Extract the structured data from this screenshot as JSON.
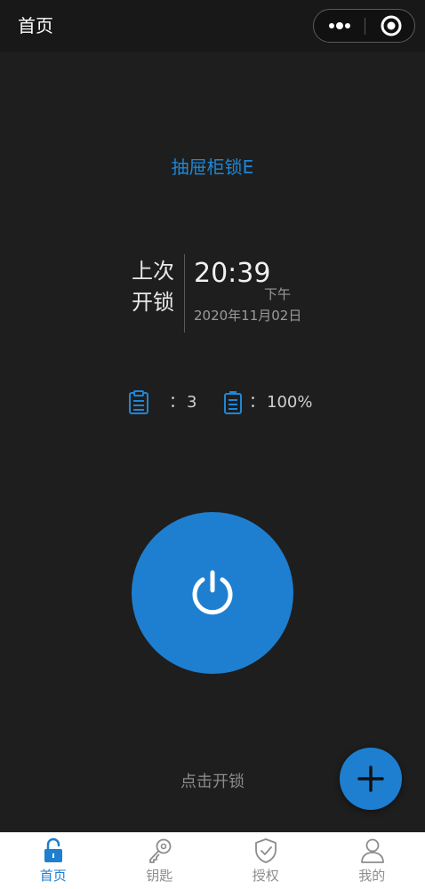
{
  "header": {
    "title": "首页",
    "capsule": {
      "more_icon": "more-dots-icon",
      "close_icon": "target-circle-icon"
    }
  },
  "device": {
    "name": "抽屉柜锁E"
  },
  "last_unlock": {
    "label_line1": "上次",
    "label_line2": "开锁",
    "time": "20:39",
    "period": "下午",
    "date": "2020年11月02日"
  },
  "stats": {
    "records": {
      "icon": "clipboard-icon",
      "colon": "：",
      "value": "3"
    },
    "battery": {
      "icon": "battery-icon",
      "colon": "：",
      "value": "100%"
    }
  },
  "actions": {
    "power_icon": "power-icon",
    "unlock_hint": "点击开锁",
    "fab_icon": "plus-icon"
  },
  "tabbar": {
    "active_index": 0,
    "items": [
      {
        "label": "首页",
        "icon": "lock-icon"
      },
      {
        "label": "钥匙",
        "icon": "key-icon"
      },
      {
        "label": "授权",
        "icon": "shield-check-icon"
      },
      {
        "label": "我的",
        "icon": "user-icon"
      }
    ]
  },
  "colors": {
    "accent": "#1e7fd0",
    "background": "#1e1e1e",
    "header_background": "#181818",
    "tab_inactive": "#8d8d8d"
  }
}
